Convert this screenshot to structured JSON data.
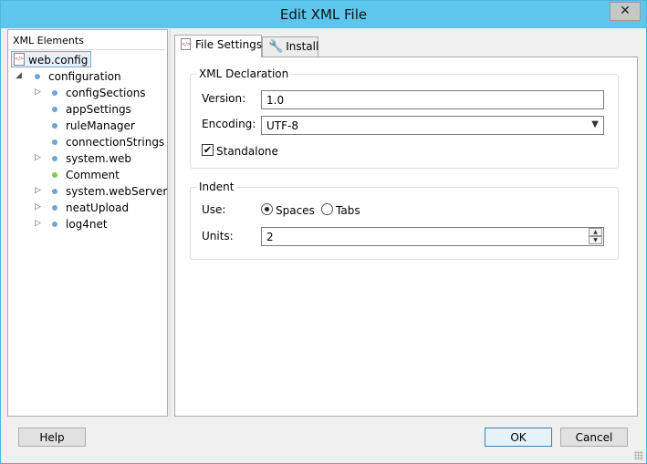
{
  "window": {
    "title": "Edit XML File",
    "close_label": "✕"
  },
  "tree": {
    "header": "XML Elements",
    "root": "web.config",
    "nodes": [
      {
        "label": "configuration",
        "expander": "◢",
        "dot": "blue"
      },
      {
        "label": "configSections",
        "expander": "▷",
        "dot": "blue"
      },
      {
        "label": "appSettings",
        "expander": "",
        "dot": "blue"
      },
      {
        "label": "ruleManager",
        "expander": "",
        "dot": "blue"
      },
      {
        "label": "connectionStrings",
        "expander": "",
        "dot": "blue"
      },
      {
        "label": "system.web",
        "expander": "▷",
        "dot": "blue"
      },
      {
        "label": "Comment",
        "expander": "",
        "dot": "green"
      },
      {
        "label": "system.webServer",
        "expander": "▷",
        "dot": "blue"
      },
      {
        "label": "neatUpload",
        "expander": "▷",
        "dot": "blue"
      },
      {
        "label": "log4net",
        "expander": "▷",
        "dot": "blue"
      }
    ]
  },
  "tabs": [
    {
      "label": "File Settings",
      "icon": "xml-file-icon",
      "active": true
    },
    {
      "label": "Install",
      "icon": "wrench-icon",
      "active": false
    }
  ],
  "xml_declaration": {
    "title": "XML Declaration",
    "version_label": "Version:",
    "version_value": "1.0",
    "encoding_label": "Encoding:",
    "encoding_value": "UTF-8",
    "standalone_label": "Standalone",
    "standalone_checked": true
  },
  "indent": {
    "title": "Indent",
    "use_label": "Use:",
    "spaces_label": "Spaces",
    "tabs_label": "Tabs",
    "selected": "Spaces",
    "units_label": "Units:",
    "units_value": "2"
  },
  "buttons": {
    "help": "Help",
    "ok": "OK",
    "cancel": "Cancel"
  },
  "colors": {
    "titlebar": "#5ec6ec",
    "panel_bg": "#f0f0f0",
    "selection": "#e6f0fb"
  }
}
